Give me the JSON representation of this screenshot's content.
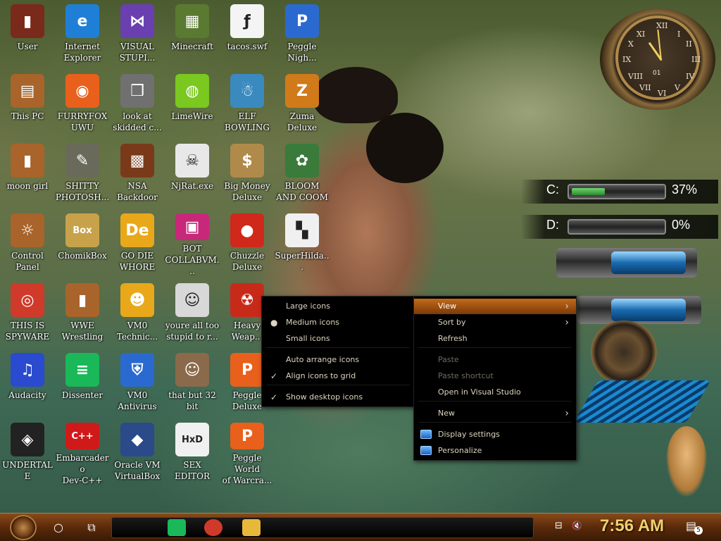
{
  "desktop": {
    "icons": [
      {
        "label": "User",
        "icon": "user-folder-icon",
        "color": "#7a2a1a",
        "glyph": "▮"
      },
      {
        "label": "Internet\nExplorer",
        "icon": "edge-icon",
        "color": "#1f7fd6",
        "glyph": "e"
      },
      {
        "label": "VISUAL\nSTUPI...",
        "icon": "visual-studio-icon",
        "color": "#6a3fb0",
        "glyph": "⋈"
      },
      {
        "label": "Minecraft",
        "icon": "minecraft-icon",
        "color": "#5a7a32",
        "glyph": "▦"
      },
      {
        "label": "tacos.swf",
        "icon": "swf-file-icon",
        "color": "#f4f4f4",
        "glyph": "ƒ"
      },
      {
        "label": "Peggle\nNigh...",
        "icon": "peggle-icon",
        "color": "#2a6ad0",
        "glyph": "P"
      },
      {
        "label": "This PC",
        "icon": "this-pc-icon",
        "color": "#a8642a",
        "glyph": "▤"
      },
      {
        "label": "FURRYFOX\nUWU",
        "icon": "firefox-icon",
        "color": "#e8601c",
        "glyph": "◉"
      },
      {
        "label": "look at\nskidded c...",
        "icon": "stacked-windows-icon",
        "color": "#707070",
        "glyph": "❒"
      },
      {
        "label": "LimeWire",
        "icon": "limewire-icon",
        "color": "#7ac820",
        "glyph": "◍"
      },
      {
        "label": "ELF\nBOWLING",
        "icon": "elf-bowling-icon",
        "color": "#3a8ac0",
        "glyph": "☃"
      },
      {
        "label": "Zuma Deluxe",
        "icon": "zuma-icon",
        "color": "#d07a1a",
        "glyph": "Z"
      },
      {
        "label": "moon girl",
        "icon": "moon-girl-folder-icon",
        "color": "#a8642a",
        "glyph": "▮"
      },
      {
        "label": "SHITTY\nPHOTOSH...",
        "icon": "gimp-icon",
        "color": "#6a6a5a",
        "glyph": "✎"
      },
      {
        "label": "NSA\nBackdoor",
        "icon": "nsa-backdoor-icon",
        "color": "#7a3a1a",
        "glyph": "▩"
      },
      {
        "label": "NjRat.exe",
        "icon": "skull-icon",
        "color": "#e8e8e8",
        "glyph": "☠"
      },
      {
        "label": "Big Money\nDeluxe",
        "icon": "money-bag-icon",
        "color": "#b08a4a",
        "glyph": "$"
      },
      {
        "label": "BLOOM\nAND COOM",
        "icon": "flower-icon",
        "color": "#3a7a3a",
        "glyph": "✿"
      },
      {
        "label": "Control Panel",
        "icon": "control-panel-icon",
        "color": "#a8642a",
        "glyph": "☼"
      },
      {
        "label": "ChomikBox",
        "icon": "chomikbox-icon",
        "color": "#c8a24a",
        "glyph": "Box"
      },
      {
        "label": "GO DIE\nWHORE",
        "icon": "godie-icon",
        "color": "#e8a81a",
        "glyph": "De"
      },
      {
        "label": "BOT\nCOLLABVM...",
        "icon": "bot-monitor-icon",
        "color": "#c8287a",
        "glyph": "▣"
      },
      {
        "label": "Chuzzle\nDeluxe",
        "icon": "chuzzle-icon",
        "color": "#d0281a",
        "glyph": "●"
      },
      {
        "label": "SuperHilda...",
        "icon": "pixel-cat-icon",
        "color": "#f0f0f0",
        "glyph": "▚"
      },
      {
        "label": "THIS IS\nSPYWARE",
        "icon": "chrome-icon",
        "color": "#d03a2a",
        "glyph": "◎"
      },
      {
        "label": "WWE\nWrestling",
        "icon": "wwe-folder-icon",
        "color": "#a8642a",
        "glyph": "▮"
      },
      {
        "label": "VM0\nTechnic...",
        "icon": "technician-icon",
        "color": "#e8a81a",
        "glyph": "☻"
      },
      {
        "label": "youre all too\nstupid to r...",
        "icon": "portrait-icon",
        "color": "#d8d8d8",
        "glyph": "☺"
      },
      {
        "label": "Heavy\nWeap...",
        "icon": "radiation-icon",
        "color": "#c82a1a",
        "glyph": "☢"
      },
      {
        "label": "Audacity",
        "icon": "audacity-icon",
        "color": "#2a4ad0",
        "glyph": "♫"
      },
      {
        "label": "Dissenter",
        "icon": "dissenter-icon",
        "color": "#1ab858",
        "glyph": "≡"
      },
      {
        "label": "VM0\nAntivirus",
        "icon": "shield-icon",
        "color": "#2a6ad0",
        "glyph": "⛨"
      },
      {
        "label": "that but 32\nbit",
        "icon": "painting-icon",
        "color": "#8a6a4a",
        "glyph": "☺"
      },
      {
        "label": "Peggle\nDeluxe",
        "icon": "peggle-deluxe-icon",
        "color": "#e8601c",
        "glyph": "P"
      },
      {
        "label": "UNDERTALE",
        "icon": "unity-icon",
        "color": "#222222",
        "glyph": "◈"
      },
      {
        "label": "Embarcadero\nDev-C++",
        "icon": "devcpp-icon",
        "color": "#d01a1a",
        "glyph": "C++"
      },
      {
        "label": "Oracle VM\nVirtualBox",
        "icon": "virtualbox-icon",
        "color": "#2a4a8a",
        "glyph": "◆"
      },
      {
        "label": "SEX\nEDITOR",
        "icon": "hxd-icon",
        "color": "#f0f0f0",
        "glyph": "HxD"
      },
      {
        "label": "Peggle World\nof Warcra...",
        "icon": "peggle-wow-icon",
        "color": "#e8601c",
        "glyph": "P"
      }
    ]
  },
  "widgets": {
    "clock": {
      "sub_dial": "01"
    },
    "drives": [
      {
        "label": "C:",
        "percent_text": "37%",
        "used_fraction": 0.37
      },
      {
        "label": "D:",
        "percent_text": "0%",
        "used_fraction": 0.0
      }
    ]
  },
  "view_submenu": {
    "items": [
      {
        "label": "Large icons",
        "checked": false,
        "marker": ""
      },
      {
        "label": "Medium icons",
        "checked": true,
        "marker": "●"
      },
      {
        "label": "Small icons",
        "checked": false,
        "marker": ""
      },
      {
        "label": "Auto arrange icons",
        "checked": false,
        "marker": ""
      },
      {
        "label": "Align icons to grid",
        "checked": true,
        "marker": "✓"
      },
      {
        "label": "Show desktop icons",
        "checked": true,
        "marker": "✓"
      }
    ]
  },
  "context_menu": {
    "items": [
      {
        "label": "View",
        "arrow": "›",
        "highlighted": true
      },
      {
        "label": "Sort by",
        "arrow": "›"
      },
      {
        "label": "Refresh"
      },
      {
        "label": "Paste",
        "disabled": true
      },
      {
        "label": "Paste shortcut",
        "disabled": true
      },
      {
        "label": "Open in Visual Studio"
      },
      {
        "label": "New",
        "arrow": "›"
      },
      {
        "label": "Display settings",
        "icon": "display-settings-icon"
      },
      {
        "label": "Personalize",
        "icon": "personalize-icon"
      }
    ]
  },
  "taskbar": {
    "search_glyph": "○",
    "taskview_glyph": "⧉",
    "pinned": [
      {
        "name": "dissenter-taskbar-icon",
        "color": "#1ab858"
      },
      {
        "name": "chrome-taskbar-icon",
        "color": "#d03a2a"
      },
      {
        "name": "file-explorer-taskbar-icon",
        "color": "#e8b83a"
      }
    ],
    "time": "7:56 AM",
    "notification_count": "5",
    "network_glyph": "⊟",
    "volume_glyph": "🔇",
    "notification_glyph": "▤"
  },
  "colors": {
    "menu_highlight": "#c26a1a",
    "taskbar": "#5a2a0a",
    "clock_text": "#f0d070"
  }
}
